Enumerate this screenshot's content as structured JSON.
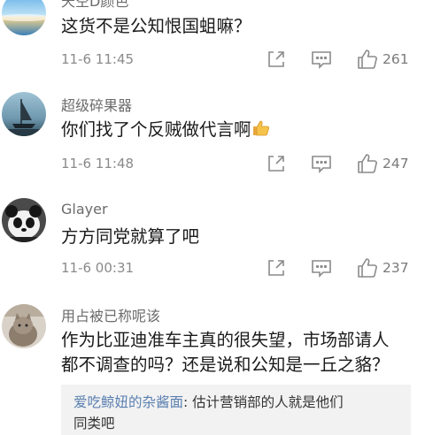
{
  "comments": [
    {
      "username": "天空D颜色",
      "text": "这货不是公知恨国蛆嘛？",
      "time": "11-6 11:45",
      "likes": "261",
      "avatar": "ocean-sky-avatar"
    },
    {
      "username": "超级碎果器",
      "text": "你们找了个反贼做代言啊",
      "time": "11-6 11:48",
      "likes": "247",
      "avatar": "sailboat-avatar",
      "emoji": "thumbs-up-emoji"
    },
    {
      "username": "Glayer",
      "text": "方方同党就算了吧",
      "time": "11-6 00:31",
      "likes": "237",
      "avatar": "panda-avatar"
    },
    {
      "username": "用占被已称呢该",
      "text_line1": "作为比亚迪准车主真的很失望，市场部请人",
      "text_line2": "都不调查的吗？还是说和公知是一丘之貉？",
      "avatar": "cat-avatar",
      "reply": {
        "name": "爱吃鲸妞的杂酱面",
        "separator": ": ",
        "line1": "估计营销部的人就是他们",
        "line2": "同类吧"
      }
    }
  ],
  "icons": [
    "share-icon",
    "reply-comment-icon",
    "like-thumb-icon"
  ],
  "colors": {
    "username": "#6b6b6b",
    "meta": "#8a8a8a",
    "reply_name": "#5a7fb0",
    "reply_bg": "#f2f2f2"
  }
}
